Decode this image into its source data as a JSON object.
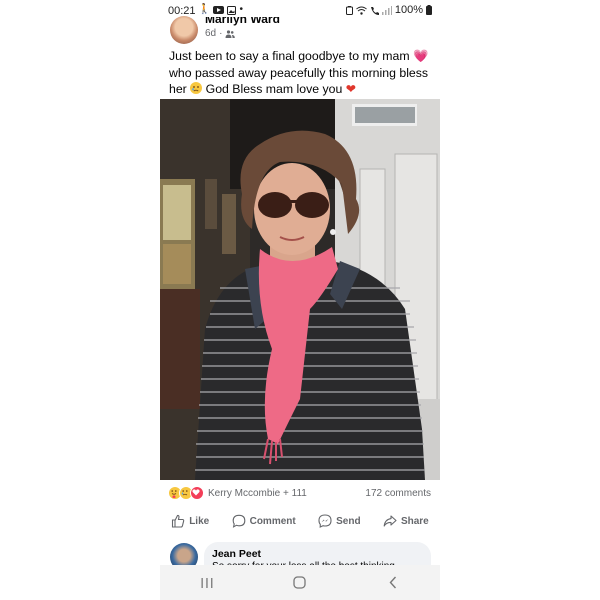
{
  "status_bar": {
    "time": "00:21",
    "battery": "100%"
  },
  "post": {
    "author": "Marilyn Ward",
    "age": "6d",
    "privacy_icon": "friends-icon",
    "text_part1": "Just been to say a final goodbye to my mam",
    "text_part2": "who passed away peacefully this morning bless her",
    "text_part3": "God Bless mam love you",
    "emoji_pink_heart": "💗",
    "emoji_red_heart": "❤",
    "photo_icon": "photo-of-woman-with-sunglasses-and-pink-scarf"
  },
  "reactions": {
    "types": [
      "care",
      "sad",
      "love"
    ],
    "reactors": "Kerry Mccombie + 111",
    "comments": "172 comments"
  },
  "actions": {
    "like": "Like",
    "comment": "Comment",
    "send": "Send",
    "share": "Share"
  },
  "comment": {
    "author": "Jean Peet",
    "text": "So sorry for your loss all the best thinking"
  },
  "colors": {
    "meta_gray": "#65676b",
    "love": "#f33e58",
    "haha": "#f7c740",
    "bubble": "#f0f2f5"
  }
}
